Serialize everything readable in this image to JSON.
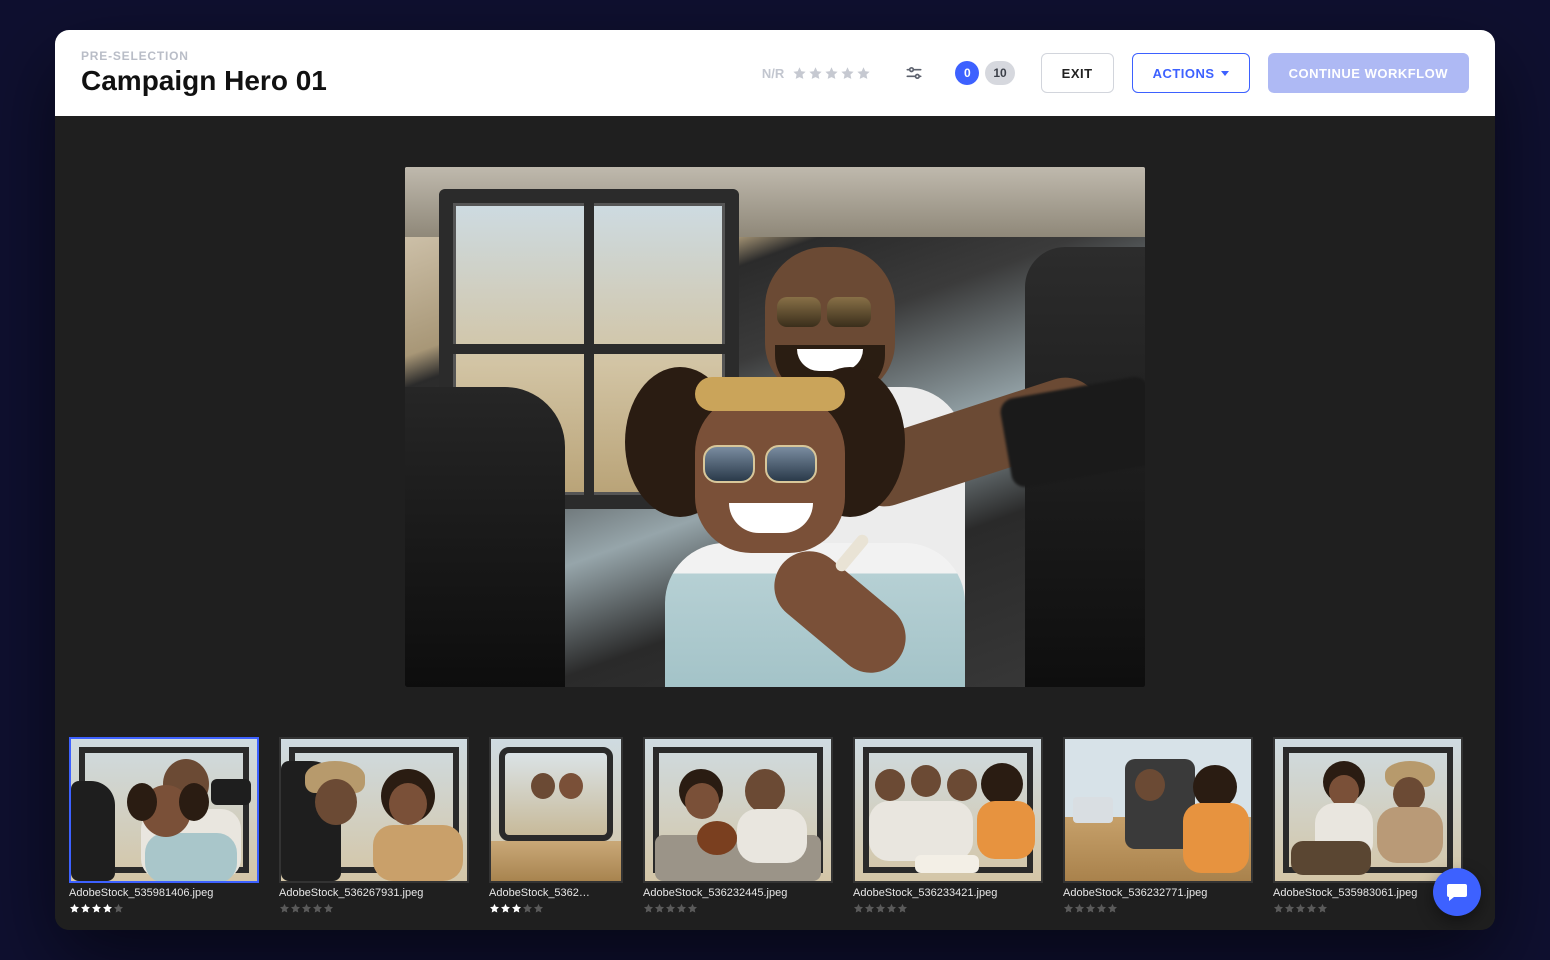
{
  "header": {
    "eyebrow": "PRE-SELECTION",
    "title": "Campaign Hero 01",
    "nr_label": "N/R",
    "rating_value": 0,
    "rating_max": 5,
    "badge_primary": "0",
    "badge_secondary": "10",
    "exit_label": "EXIT",
    "actions_label": "ACTIONS",
    "continue_label": "CONTINUE WORKFLOW"
  },
  "thumbnails": [
    {
      "filename": "AdobeStock_535981406.jpeg",
      "rating": 4,
      "selected": true
    },
    {
      "filename": "AdobeStock_536267931.jpeg",
      "rating": 0,
      "selected": false
    },
    {
      "filename": "AdobeStock_5362…",
      "rating": 3,
      "selected": false
    },
    {
      "filename": "AdobeStock_536232445.jpeg",
      "rating": 0,
      "selected": false
    },
    {
      "filename": "AdobeStock_536233421.jpeg",
      "rating": 0,
      "selected": false
    },
    {
      "filename": "AdobeStock_536232771.jpeg",
      "rating": 0,
      "selected": false
    },
    {
      "filename": "AdobeStock_535983061.jpeg",
      "rating": 0,
      "selected": false
    }
  ]
}
